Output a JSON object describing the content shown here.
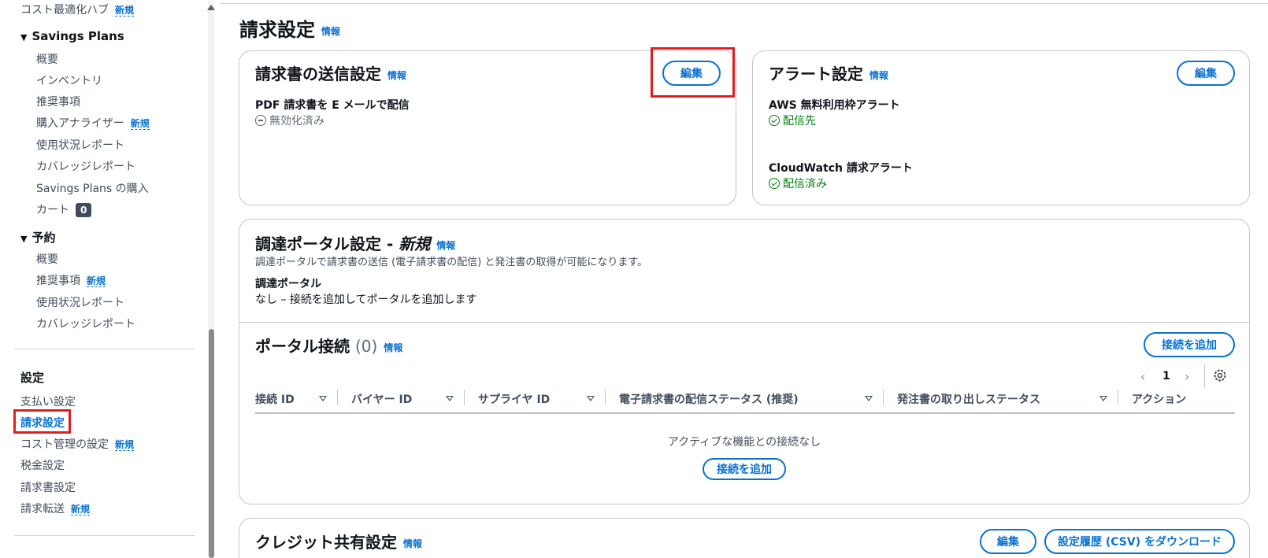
{
  "sidebar": {
    "top_item": {
      "label": "コスト最適化ハブ",
      "badge": "新規"
    },
    "savings_plans": {
      "heading": "Savings Plans",
      "items": [
        {
          "label": "概要"
        },
        {
          "label": "インベントリ"
        },
        {
          "label": "推奨事項"
        },
        {
          "label": "購入アナライザー",
          "badge": "新規"
        },
        {
          "label": "使用状況レポート"
        },
        {
          "label": "カバレッジレポート"
        },
        {
          "label": "Savings Plans の購入"
        },
        {
          "label": "カート",
          "count": "0"
        }
      ]
    },
    "reservations": {
      "heading": "予約",
      "items": [
        {
          "label": "概要"
        },
        {
          "label": "推奨事項",
          "badge": "新規"
        },
        {
          "label": "使用状況レポート"
        },
        {
          "label": "カバレッジレポート"
        }
      ]
    },
    "settings": {
      "heading": "設定",
      "items": [
        {
          "label": "支払い設定"
        },
        {
          "label": "請求設定"
        },
        {
          "label": "コスト管理の設定",
          "badge": "新規"
        },
        {
          "label": "税金設定"
        },
        {
          "label": "請求書設定"
        },
        {
          "label": "請求転送",
          "badge": "新規"
        }
      ]
    }
  },
  "page": {
    "title": "請求設定",
    "info": "情報"
  },
  "invoice_delivery": {
    "title": "請求書の送信設定",
    "info": "情報",
    "edit": "編集",
    "field_label": "PDF 請求書を E メールで配信",
    "field_value": "無効化済み"
  },
  "alerts": {
    "title": "アラート設定",
    "info": "情報",
    "edit": "編集",
    "free_tier_label": "AWS 無料利用枠アラート",
    "free_tier_value": "配信先",
    "cloudwatch_label": "CloudWatch 請求アラート",
    "cloudwatch_value": "配信済み"
  },
  "procurement": {
    "title": "調達ポータル設定 - ",
    "title_new": "新規",
    "info": "情報",
    "description": "調達ポータルで請求書の送信 (電子請求書の配信) と発注書の取得が可能になります。",
    "portal_label": "調達ポータル",
    "portal_value": "なし – 接続を追加してポータルを追加します"
  },
  "portal_connections": {
    "title": "ポータル接続",
    "count": "(0)",
    "info": "情報",
    "add_button": "接続を追加",
    "page": "1",
    "columns": [
      "接続 ID",
      "バイヤー ID",
      "サプライヤ ID",
      "電子請求書の配信ステータス (推奨)",
      "発注書の取り出しステータス",
      "アクション"
    ],
    "empty_text": "アクティブな機能との接続なし",
    "empty_button": "接続を追加"
  },
  "credit_sharing": {
    "title": "クレジット共有設定",
    "info": "情報",
    "edit": "編集",
    "download": "設定履歴 (CSV) をダウンロード"
  },
  "colors": {
    "accent": "#0972d3",
    "success": "#037f0c",
    "highlight": "#e01e1e"
  }
}
